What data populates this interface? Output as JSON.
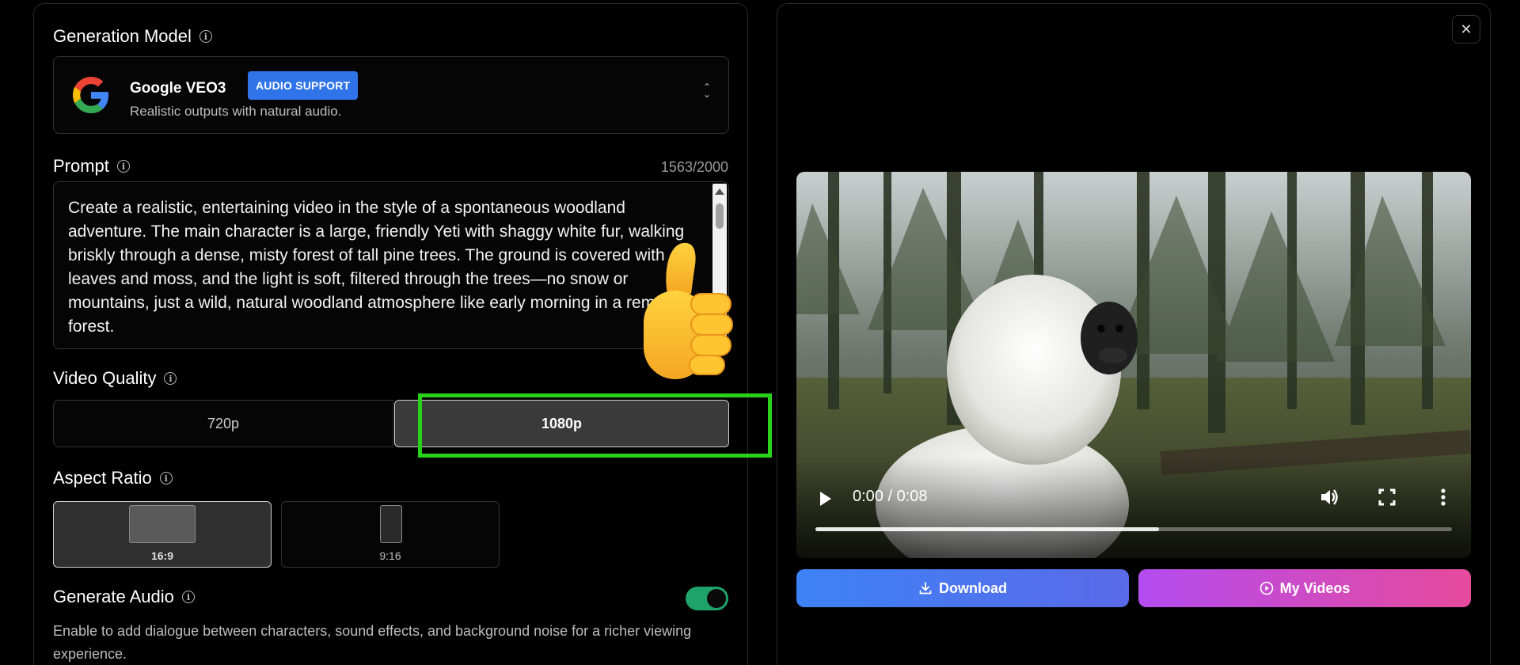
{
  "left_panel": {
    "generation_model": {
      "title": "Generation Model",
      "model_name": "Google VEO3",
      "badge": "AUDIO SUPPORT",
      "description": "Realistic outputs with natural audio.",
      "icons": [
        "google-logo",
        "info-icon",
        "chevron-updown-icon"
      ]
    },
    "prompt": {
      "title": "Prompt",
      "counter_used": "1563",
      "counter_max": "/2000",
      "text": "Create a realistic, entertaining video in the style of a spontaneous woodland adventure. The main character is a large, friendly Yeti with shaggy white fur, walking briskly through a dense, misty forest of tall pine trees. The ground is covered with leaves and moss, and the light is soft, filtered through the trees—no snow or mountains, just a wild, natural woodland atmosphere like early morning in a remote forest."
    },
    "video_quality": {
      "title": "Video Quality",
      "options": [
        "720p",
        "1080p"
      ],
      "selected": "1080p"
    },
    "aspect_ratio": {
      "title": "Aspect Ratio",
      "options": [
        "16:9",
        "9:16"
      ],
      "selected": "16:9"
    },
    "generate_audio": {
      "title": "Generate Audio",
      "enabled": true,
      "description": "Enable to add dialogue between characters, sound effects, and background noise for a richer viewing experience."
    }
  },
  "right_panel": {
    "close_label": "✕",
    "player": {
      "time": "0:00 / 0:08",
      "progress": 0.54
    },
    "buttons": {
      "download": "Download",
      "my_videos": "My Videos"
    }
  },
  "colors": {
    "badge_blue": "#2f74e8",
    "highlight_green": "#28d21b",
    "toggle_green": "#1fa36b",
    "download_gradient": [
      "#3d82f7",
      "#5a6ae8"
    ],
    "myvideos_gradient": [
      "#b44cf0",
      "#e64a9c"
    ]
  }
}
